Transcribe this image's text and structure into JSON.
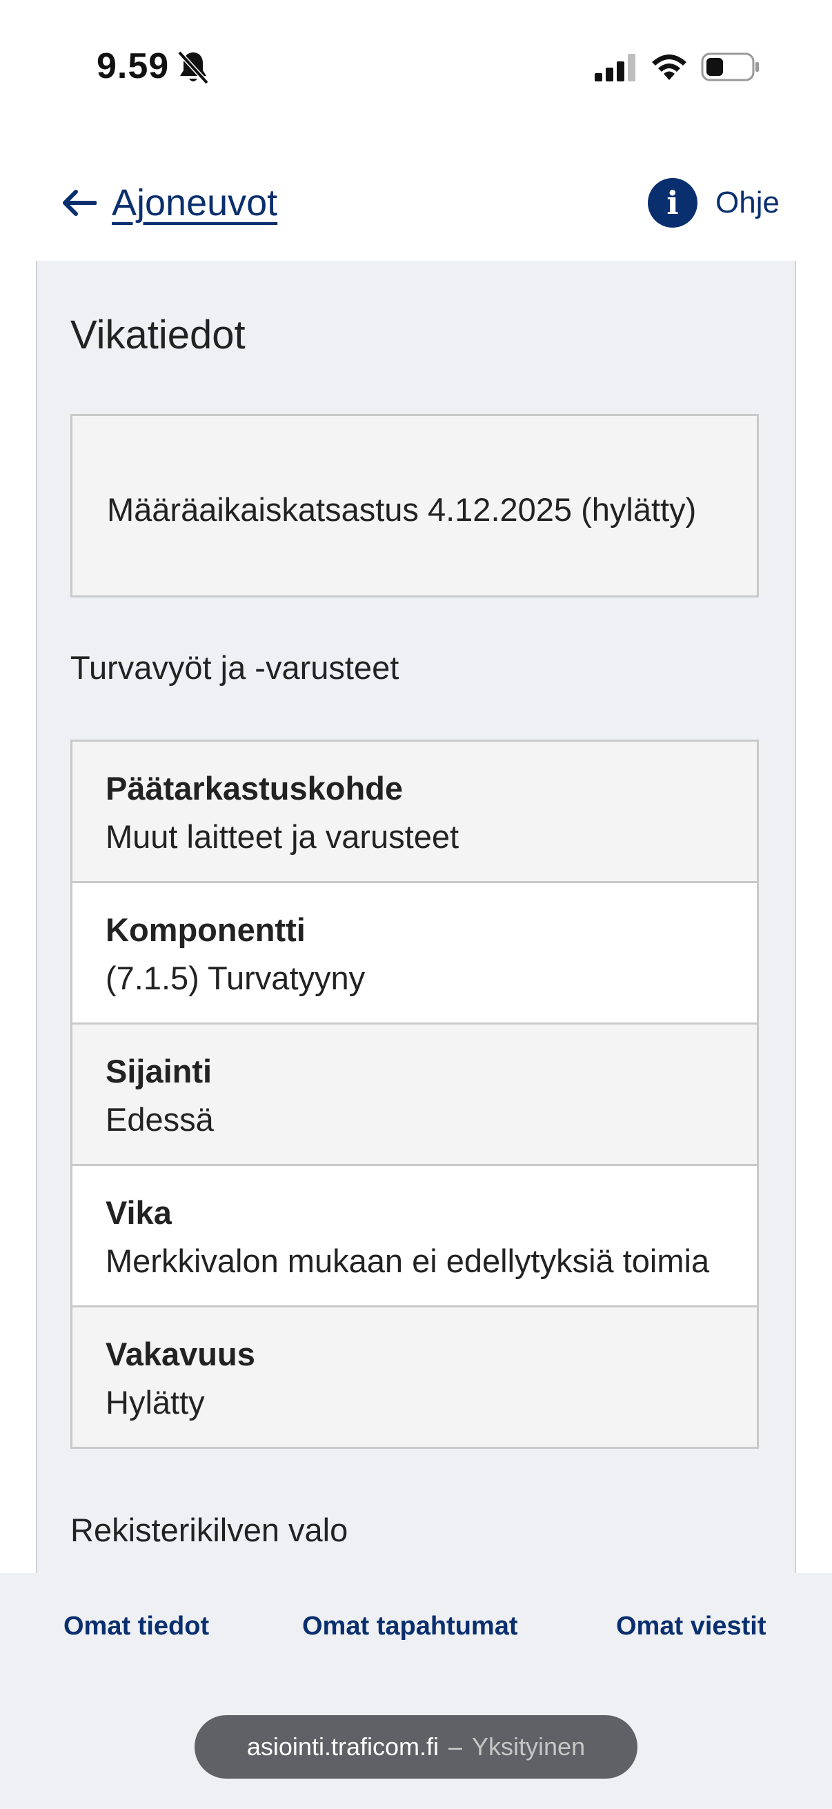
{
  "status_bar": {
    "time": "9.59",
    "icons": [
      "bell-slash-icon",
      "signal-icon",
      "wifi-icon",
      "battery-icon"
    ]
  },
  "header": {
    "back_label": "Ajoneuvot",
    "help_label": "Ohje",
    "back_icon": "arrow-left-icon",
    "help_icon": "info-icon"
  },
  "main": {
    "title": "Vikatiedot",
    "inspection_result": "Määräaikaiskatsastus 4.12.2025 (hylätty)",
    "sections": [
      {
        "heading": "Turvavyöt ja -varusteet",
        "rows": [
          {
            "label": "Päätarkastuskohde",
            "value": "Muut laitteet ja varusteet"
          },
          {
            "label": "Komponentti",
            "value": "(7.1.5) Turvatyyny"
          },
          {
            "label": "Sijainti",
            "value": "Edessä"
          },
          {
            "label": "Vika",
            "value": "Merkkivalon mukaan ei edellytyksiä toimia"
          },
          {
            "label": "Vakavuus",
            "value": "Hylätty"
          }
        ]
      },
      {
        "heading": "Rekisterikilven valo"
      }
    ]
  },
  "bottom_nav": {
    "items": [
      "Omat tiedot",
      "Omat tapahtumat",
      "Omat viestit"
    ]
  },
  "browser": {
    "host": "asiointi.traficom.fi",
    "separator": "–",
    "mode": "Yksityinen"
  },
  "colors": {
    "brand": "#0a2f6e",
    "background": "#eef0f3",
    "border": "#c9c9c9"
  }
}
